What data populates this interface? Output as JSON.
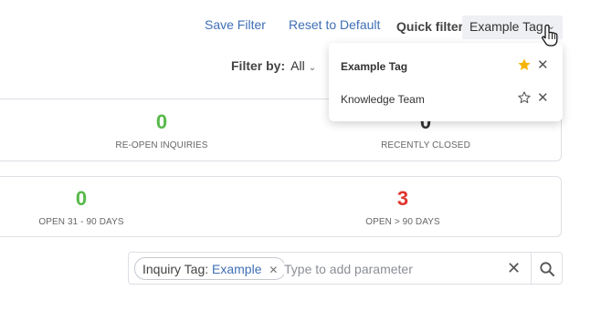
{
  "header": {
    "save_filter": "Save Filter",
    "reset_default": "Reset to Default",
    "quick_filter_label": "Quick filter:",
    "quick_filter_value": "Example Tag"
  },
  "filter_by": {
    "label": "Filter by:",
    "value": "All"
  },
  "stats_row1": [
    {
      "value": "0",
      "caption": "RE-OPEN INQUIRIES",
      "color": "#57b94a"
    },
    {
      "value": "0",
      "caption": "RECENTLY CLOSED",
      "color": "#333333"
    }
  ],
  "stats_row2": [
    {
      "value": "0",
      "caption": "OPEN 31 - 90 DAYS",
      "color": "#57b94a"
    },
    {
      "value": "3",
      "caption": "OPEN > 90 DAYS",
      "color": "#e0352e"
    }
  ],
  "search": {
    "chip_key": "Inquiry Tag:",
    "chip_value": "Example",
    "placeholder": "Type to add parameter"
  },
  "quick_filter_menu": [
    {
      "label": "Example Tag",
      "starred": true
    },
    {
      "label": "Knowledge Team",
      "starred": false
    }
  ],
  "icons": {
    "star_filled": "star-filled-icon",
    "star_outline": "star-outline-icon",
    "close": "close-icon",
    "search": "search-icon",
    "chevron": "chevron-down-icon",
    "cursor": "hand-pointer-icon"
  },
  "colors": {
    "accent": "#3f6fb5",
    "star": "#f5b400",
    "green": "#57b94a",
    "red": "#e0352e"
  }
}
